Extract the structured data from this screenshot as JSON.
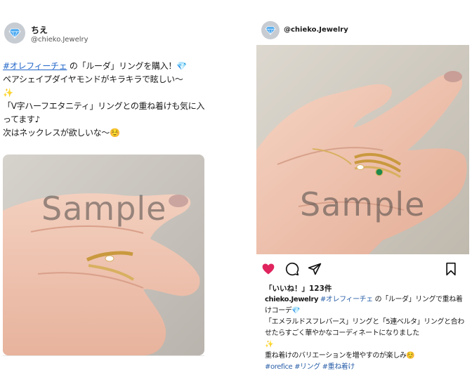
{
  "colors": {
    "link": "#1f64c8",
    "like_heart": "#e0245e",
    "avatar_bg": "#c7ccd3",
    "gem": "#4aa8f0"
  },
  "tweet": {
    "avatar_icon": "diamond-icon",
    "display_name": "ちえ",
    "handle": "@chieko.Jewelry",
    "hashtag": "#オレフィーチェ",
    "line1_rest": " の「ルーダ」リングを購入！",
    "line1_emoji": "💎",
    "line2": "ペアシェイプダイヤモンドがキラキラで眩しい〜",
    "line2_emoji": "✨",
    "line3": "「V字ハーフエタニティ」リングとの重ね着けも気に入ってます♪",
    "line4": "次はネックレスが欲しいな〜",
    "line4_emoji": "☺️",
    "photo_watermark": "Sample"
  },
  "instagram": {
    "avatar_icon": "diamond-icon",
    "handle": "@chieko.Jewelry",
    "photo_watermark": "Sample",
    "actions": [
      "heart-icon",
      "comment-icon",
      "share-icon",
      "bookmark-icon"
    ],
    "likes": "「いいね！」123件",
    "caption_user": "chieko.Jewelry",
    "caption_tag": "#オレフィーチェ",
    "caption_line1_rest": " の「ルーダ」リングで重ね着けコーデ",
    "caption_line1_emoji": "💎",
    "caption_line2": "「エメラルドスフレバース」リングと「5連ベルタ」リングと合わせたらすごく華やかなコーディネートになりました",
    "caption_line2_emoji": "✨",
    "caption_line3": "重ね着けのバリエーションを増やすのが楽しみ",
    "caption_line3_emoji": "☺️",
    "caption_hashtags": "#orefice #リング #重ね着け"
  }
}
